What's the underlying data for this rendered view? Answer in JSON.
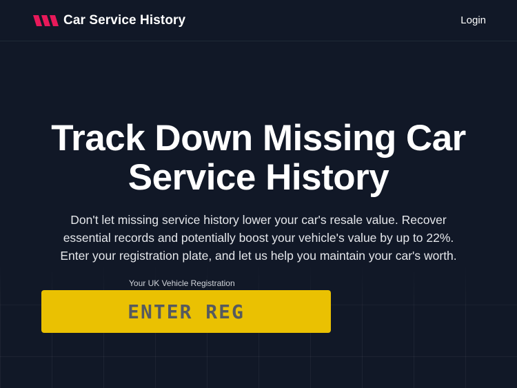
{
  "header": {
    "brand": "Car Service History",
    "logo_icon": "chevrons-right-icon",
    "login_label": "Login"
  },
  "hero": {
    "title_line1": "Track Down Missing Car",
    "title_line2": "Service History",
    "description": "Don't let missing service history lower your car's resale value. Recover essential records and potentially boost your vehicle's value by up to 22%. Enter your registration plate, and let us help you maintain your car's worth."
  },
  "registration": {
    "label": "Your UK Vehicle Registration",
    "placeholder": "ENTER REG",
    "value": ""
  },
  "colors": {
    "background": "#111827",
    "brand_accent": "#e8195a",
    "plate_yellow": "#eac102"
  }
}
